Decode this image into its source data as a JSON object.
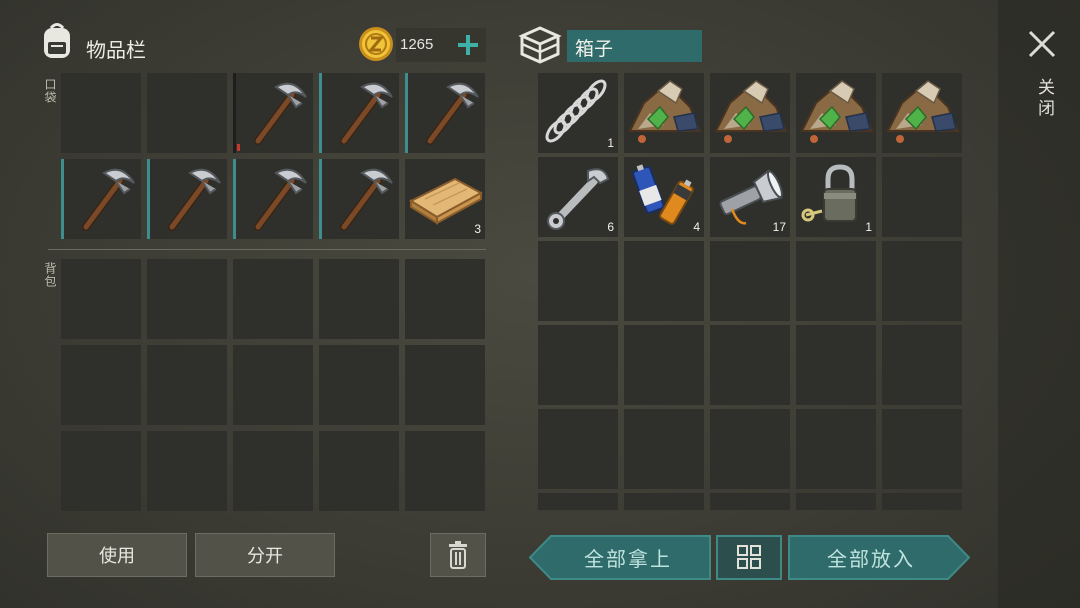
{
  "inventory": {
    "title": "物品栏",
    "coins": "1265",
    "pocket_label": "口袋",
    "backpack_label": "背包"
  },
  "box": {
    "title": "箱子",
    "close_label": "关闭"
  },
  "pocket_items": [
    {
      "name": "empty-slot",
      "qty": ""
    },
    {
      "name": "empty-slot",
      "qty": ""
    },
    {
      "name": "pickaxe",
      "qty": ""
    },
    {
      "name": "pickaxe",
      "qty": ""
    },
    {
      "name": "pickaxe",
      "qty": ""
    },
    {
      "name": "pickaxe",
      "qty": ""
    },
    {
      "name": "pickaxe",
      "qty": ""
    },
    {
      "name": "pickaxe",
      "qty": ""
    },
    {
      "name": "pickaxe",
      "qty": ""
    },
    {
      "name": "wood-plank",
      "qty": "3"
    }
  ],
  "box_items": [
    {
      "name": "spring",
      "qty": "1"
    },
    {
      "name": "ore-pile",
      "qty": ""
    },
    {
      "name": "ore-pile",
      "qty": ""
    },
    {
      "name": "ore-pile",
      "qty": ""
    },
    {
      "name": "ore-pile",
      "qty": ""
    },
    {
      "name": "wrench",
      "qty": "6"
    },
    {
      "name": "batteries",
      "qty": "4"
    },
    {
      "name": "flashlight",
      "qty": "17"
    },
    {
      "name": "padlock",
      "qty": "1"
    }
  ],
  "buttons": {
    "use": "使用",
    "split": "分开",
    "take_all": "全部拿上",
    "put_all": "全部放入"
  },
  "colors": {
    "accent": "#2f6b6b",
    "durability": "#3d8e8e",
    "durability_low": "#c63a2e",
    "coin": "#e6b530"
  }
}
